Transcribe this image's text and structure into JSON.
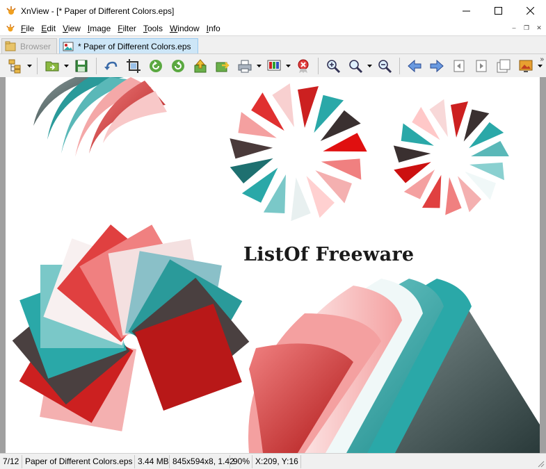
{
  "window": {
    "title": "XnView - [* Paper of Different Colors.eps]"
  },
  "menu": {
    "items": [
      "File",
      "Edit",
      "View",
      "Image",
      "Filter",
      "Tools",
      "Window",
      "Info"
    ]
  },
  "tabs": [
    {
      "label": "Browser",
      "active": false
    },
    {
      "label": "* Paper of Different Colors.eps",
      "active": true
    }
  ],
  "toolbar": {
    "buttons": [
      "browser-tree-icon",
      "open-folder-icon",
      "save-icon",
      "undo-icon",
      "crop-icon",
      "rotate-left-icon",
      "rotate-right-icon",
      "upload-icon",
      "export-icon",
      "print-icon",
      "color-adjust-icon",
      "delete-icon",
      "zoom-in-icon",
      "zoom-one-icon",
      "zoom-out-icon",
      "previous-icon",
      "next-icon",
      "first-page-icon",
      "next-page-icon",
      "last-page-icon",
      "slideshow-icon"
    ]
  },
  "image": {
    "watermark": "ListOf Freeware"
  },
  "status": {
    "index": "7/12",
    "filename": "Paper of Different Colors.eps",
    "filesize": "3.44 MB",
    "dimensions": "845x594x8, 1.42",
    "zoom": "90%",
    "cursor": "X:209, Y:16"
  },
  "colors": {
    "teal": "#2aa8a8",
    "red": "#cc2020",
    "pink": "#f0a0a0",
    "dark": "#4a4040"
  }
}
